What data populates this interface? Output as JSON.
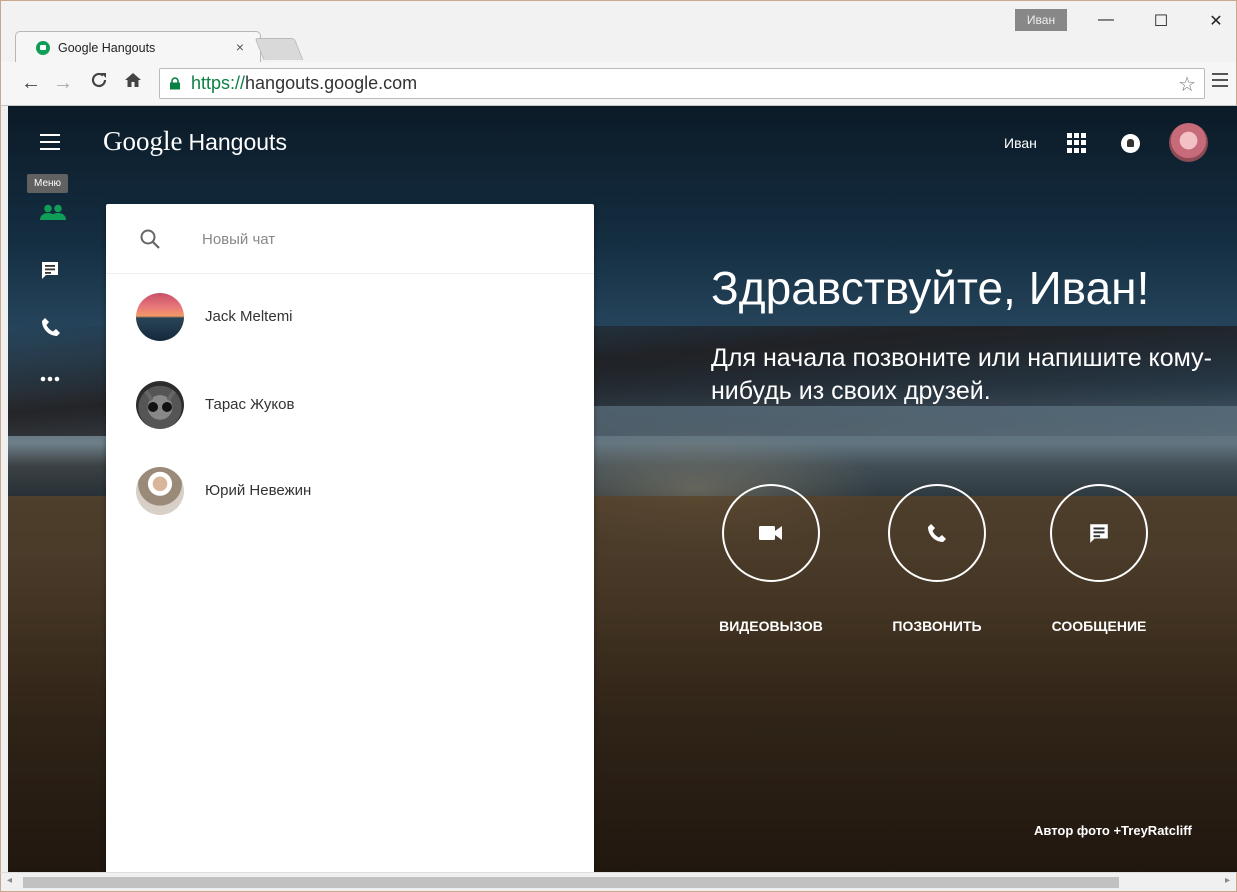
{
  "browser": {
    "tab_title": "Google Hangouts",
    "tab_close": "×",
    "profile_badge": "Иван",
    "url_scheme": "https://",
    "url_host": "hangouts.google.com",
    "window_minimize": "—",
    "window_maximize": "☐",
    "window_close": "✕"
  },
  "app": {
    "logo_google": "Google",
    "logo_product": "Hangouts",
    "menu_tooltip": "Меню",
    "user_name": "Иван"
  },
  "search": {
    "placeholder": "Новый чат"
  },
  "contacts": [
    {
      "name": "Jack Meltemi"
    },
    {
      "name": "Тарас Жуков"
    },
    {
      "name": "Юрий Невежин"
    }
  ],
  "welcome": {
    "greeting": "Здравствуйте, Иван!",
    "subtext": "Для начала позвоните или напишите кому-нибудь из своих друзей."
  },
  "actions": [
    {
      "label": "ВИДЕОВЫЗОВ",
      "icon": "video-camera-icon"
    },
    {
      "label": "ПОЗВОНИТЬ",
      "icon": "phone-icon"
    },
    {
      "label": "СООБЩЕНИЕ",
      "icon": "message-icon"
    }
  ],
  "photo_credit": "Автор фото +TreyRatcliff",
  "colors": {
    "accent_green": "#0f9d58",
    "url_green": "#0b8043",
    "tooltip": "#616161"
  }
}
